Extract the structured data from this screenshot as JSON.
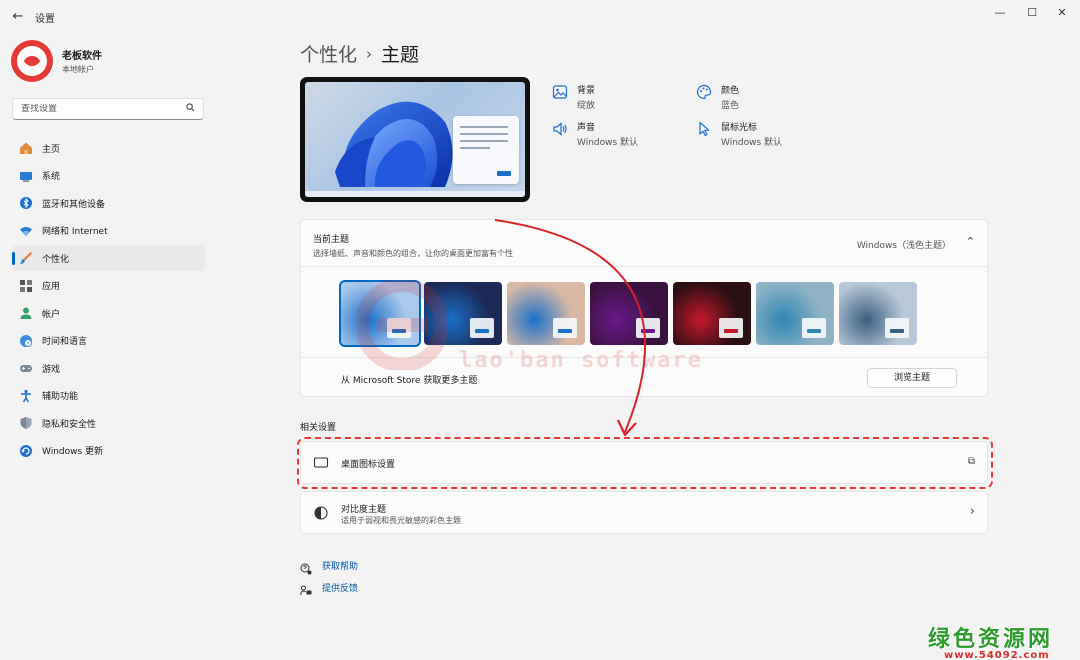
{
  "window": {
    "back_glyph": "←",
    "title": "设置",
    "min_glyph": "—",
    "max_glyph": "☐",
    "close_glyph": "✕"
  },
  "profile": {
    "name": "老板软件",
    "account": "本地帐户"
  },
  "search": {
    "placeholder": "查找设置",
    "icon": "search-icon"
  },
  "sidebar": {
    "items": [
      {
        "label": "主页",
        "icon": "home-icon",
        "active": false
      },
      {
        "label": "系统",
        "icon": "monitor-icon",
        "active": false
      },
      {
        "label": "蓝牙和其他设备",
        "icon": "bluetooth-icon",
        "active": false
      },
      {
        "label": "网络和 Internet",
        "icon": "wifi-icon",
        "active": false
      },
      {
        "label": "个性化",
        "icon": "brush-icon",
        "active": true
      },
      {
        "label": "应用",
        "icon": "apps-icon",
        "active": false
      },
      {
        "label": "帐户",
        "icon": "person-icon",
        "active": false
      },
      {
        "label": "时间和语言",
        "icon": "globe-clock-icon",
        "active": false
      },
      {
        "label": "游戏",
        "icon": "gamepad-icon",
        "active": false
      },
      {
        "label": "辅助功能",
        "icon": "accessibility-icon",
        "active": false
      },
      {
        "label": "隐私和安全性",
        "icon": "shield-icon",
        "active": false
      },
      {
        "label": "Windows 更新",
        "icon": "update-icon",
        "active": false
      }
    ]
  },
  "breadcrumb": {
    "parent": "个性化",
    "separator": "›",
    "current": "主题"
  },
  "quick_settings": {
    "background": {
      "label": "背景",
      "value": "绽放",
      "icon": "image-icon"
    },
    "color": {
      "label": "颜色",
      "value": "蓝色",
      "icon": "palette-icon"
    },
    "sound": {
      "label": "声音",
      "value": "Windows 默认",
      "icon": "speaker-icon"
    },
    "cursor": {
      "label": "鼠标光标",
      "value": "Windows 默认",
      "icon": "cursor-icon"
    }
  },
  "current_theme": {
    "title": "当前主题",
    "subtitle": "选择墙纸、声音和颜色的组合，让你的桌面更加富有个性",
    "current_name": "Windows（浅色主题）",
    "chevron": "⌃",
    "store_text": "从 Microsoft Store 获取更多主题",
    "browse_label": "浏览主题",
    "themes": [
      {
        "name": "windows-light",
        "selected": true,
        "bg": "#a9c8ec",
        "accent": "#1a6fc9"
      },
      {
        "name": "windows-dark",
        "selected": false,
        "bg": "#1d2a57",
        "accent": "#1a6fc9"
      },
      {
        "name": "spotlight",
        "selected": false,
        "bg": "#d9b9a6",
        "accent": "#1a6fc9"
      },
      {
        "name": "glow",
        "selected": false,
        "bg": "#3a1240",
        "accent": "#6a1a8a"
      },
      {
        "name": "captured-motion",
        "selected": false,
        "bg": "#2a0f14",
        "accent": "#c4182b"
      },
      {
        "name": "sunrise",
        "selected": false,
        "bg": "#8fb3c4",
        "accent": "#2f86b5"
      },
      {
        "name": "flow",
        "selected": false,
        "bg": "#b9c8d8",
        "accent": "#3a5f80"
      }
    ]
  },
  "watermark": {
    "text": "lao'ban software"
  },
  "related": {
    "title": "相关设置",
    "desktop_icons": {
      "label": "桌面图标设置",
      "icon": "desktop-icon",
      "end_icon": "external-link-icon",
      "end_glyph": "⧉"
    },
    "contrast": {
      "label": "对比度主题",
      "subtitle": "适用于弱视和畏光敏感的彩色主题",
      "icon": "contrast-icon",
      "end_glyph": "›"
    }
  },
  "links": {
    "help": {
      "label": "获取帮助",
      "icon": "help-icon"
    },
    "feedback": {
      "label": "提供反馈",
      "icon": "feedback-icon"
    }
  },
  "corner_brand": {
    "main": "绿色资源网",
    "sub": "www.54092.com"
  },
  "colors": {
    "accent": "#0067c0",
    "highlight": "#e53935",
    "link": "#0054a6"
  }
}
